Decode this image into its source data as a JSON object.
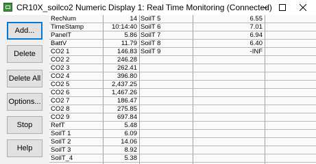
{
  "window": {
    "title": "CR10X_soilco2 Numeric Display 1: Real Time Monitoring (Connected)"
  },
  "buttons": [
    {
      "label": "Add..."
    },
    {
      "label": "Delete"
    },
    {
      "label": "Delete All"
    },
    {
      "label": "Options..."
    },
    {
      "label": "Stop"
    },
    {
      "label": "Help"
    }
  ],
  "left_table": [
    {
      "name": "RecNum",
      "value": "14"
    },
    {
      "name": "TimeStamp",
      "value": "10:14:40"
    },
    {
      "name": "PanelT",
      "value": "5.86"
    },
    {
      "name": "BattV",
      "value": "11.79"
    },
    {
      "name": "CO2  1",
      "value": "146.83"
    },
    {
      "name": "CO2  2",
      "value": "246.28"
    },
    {
      "name": "CO2  3",
      "value": "262.41"
    },
    {
      "name": "CO2  4",
      "value": "396.80"
    },
    {
      "name": "CO2  5",
      "value": "2,437.25"
    },
    {
      "name": "CO2  6",
      "value": "1,467.26"
    },
    {
      "name": "CO2  7",
      "value": "186.47"
    },
    {
      "name": "CO2  8",
      "value": "275.85"
    },
    {
      "name": "CO2  9",
      "value": "697.84"
    },
    {
      "name": "RefT",
      "value": "5.48"
    },
    {
      "name": "SoilT  1",
      "value": "6.09"
    },
    {
      "name": "SoilT  2",
      "value": "14.06"
    },
    {
      "name": "SoilT  3",
      "value": "8.92"
    },
    {
      "name": "SoilT_4",
      "value": "5.38"
    }
  ],
  "right_table": [
    {
      "name": "SoilT  5",
      "value": "6.55"
    },
    {
      "name": "SoilT  6",
      "value": "7.01"
    },
    {
      "name": "SoilT  7",
      "value": "6.94"
    },
    {
      "name": "SoilT  8",
      "value": "6.40"
    },
    {
      "name": "SoilT  9",
      "value": "-INF"
    }
  ]
}
